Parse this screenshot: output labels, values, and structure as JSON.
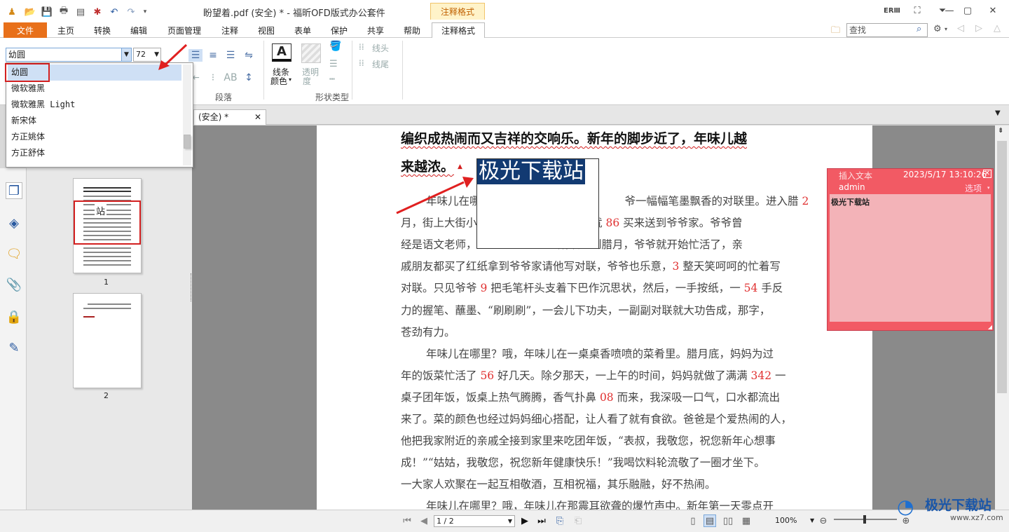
{
  "title": {
    "doc_title": "盼望着.pdf (安全) * - 福昕OFD版式办公套件",
    "context_tab": "注释格式"
  },
  "menu": {
    "file": "文件",
    "items": [
      "主页",
      "转换",
      "编辑",
      "页面管理",
      "注释",
      "视图",
      "表单",
      "保护",
      "共享",
      "帮助"
    ],
    "active": "注释格式"
  },
  "search": {
    "placeholder": "查找"
  },
  "ribbon": {
    "font_value": "幼圆",
    "size_value": "72",
    "group_paragraph": "段落",
    "line_color_label": "线条",
    "line_color_label2": "颜色",
    "opacity_label": "透明",
    "opacity_label2": "度",
    "group_shape": "形状类型",
    "line_head": "线头",
    "line_tail": "线尾"
  },
  "font_list": [
    "幼圆",
    "微软雅黑",
    "微软雅黑 Light",
    "新宋体",
    "方正姚体",
    "方正舒体"
  ],
  "thumbnails": {
    "page1_label": "1",
    "page2_label": "2",
    "page1_overlay": "站"
  },
  "doc_tab": {
    "label": "(安全) *"
  },
  "document": {
    "heading_line1": "编织成热闹而又吉祥的交响乐。新年的脚步近了，年味儿越",
    "heading_line2": "来越浓。",
    "textbox_text": "极光下载站",
    "lines": [
      {
        "pre": "年味儿在哪",
        "mid": "",
        "post": "爷一幅幅笔墨飘香的对联里。进入腊 ",
        "num": "2",
        "indent": true,
        "gap": true
      },
      {
        "pre": "月，街上大街小",
        "post": "，我们就 ",
        "num": "86",
        "tail": " 买来送到爷爷家。爷爷曾",
        "gap": true
      },
      {
        "pre": "经是语文老师，",
        "post": "所以一到腊月，爷爷就开始忙活了，亲",
        "gap": true
      },
      {
        "pre": "戚朋友都买了红纸拿到爷爷家请他写对联，爷爷也乐意，",
        "num": "3",
        "tail": " 整天笑呵呵的忙着写"
      },
      {
        "pre": "对联。只见爷爷 ",
        "num": "9",
        "tail": " 把毛笔杆头支着下巴作沉思状，然后，一手按纸，一 ",
        "num2": "54",
        "tail2": " 手反"
      },
      {
        "pre": "力的握笔、蘸墨、“刷刷刷”，一会儿下功夫，一副副对联就大功告成，那字，"
      },
      {
        "pre": "苍劲有力。"
      },
      {
        "pre": "年味儿在哪里？哦，年味儿在一桌桌香喷喷的菜肴里。腊月底，妈妈为过",
        "indent": true
      },
      {
        "pre": "年的饭菜忙活了 ",
        "num": "56",
        "tail": " 好几天。除夕那天，一上午的时间，妈妈就做了满满 ",
        "num2": "342",
        "tail2": " 一"
      },
      {
        "pre": "桌子团年饭，饭桌上热气腾腾，香气扑鼻 ",
        "num": "08",
        "tail": " 而来，我深吸一口气，口水都流出"
      },
      {
        "pre": "来了。菜的颜色也经过妈妈细心搭配，让人看了就有食欲。爸爸是个爱热闹的人，"
      },
      {
        "pre": "他把我家附近的亲戚全接到家里来吃团年饭，“表叔，我敬您，祝您新年心想事"
      },
      {
        "pre": "成！”“姑姑，我敬您，祝您新年健康快乐！”我喝饮料轮流敬了一圈才坐下。"
      },
      {
        "pre": "一大家人欢聚在一起互相敬酒，互相祝福，其乐融融，好不热闹。"
      },
      {
        "pre": "年味儿在哪里？哦，年味儿在那震耳欲聋的爆竹声中。新年第一天零点开",
        "indent": true
      }
    ]
  },
  "popup": {
    "type": "插入文本",
    "date": "2023/5/17 13:10:26",
    "author": "admin",
    "options": "选项",
    "content": "极光下载站"
  },
  "status": {
    "page_value": "1 / 2",
    "zoom": "100%"
  },
  "watermark": {
    "text": "极光下载站",
    "url": "www.xz7.com"
  },
  "colors": {
    "accent": "#e8701a",
    "annotation": "#f25a64",
    "highlight_box": "#d32020",
    "textbox_bg": "#123a72"
  }
}
